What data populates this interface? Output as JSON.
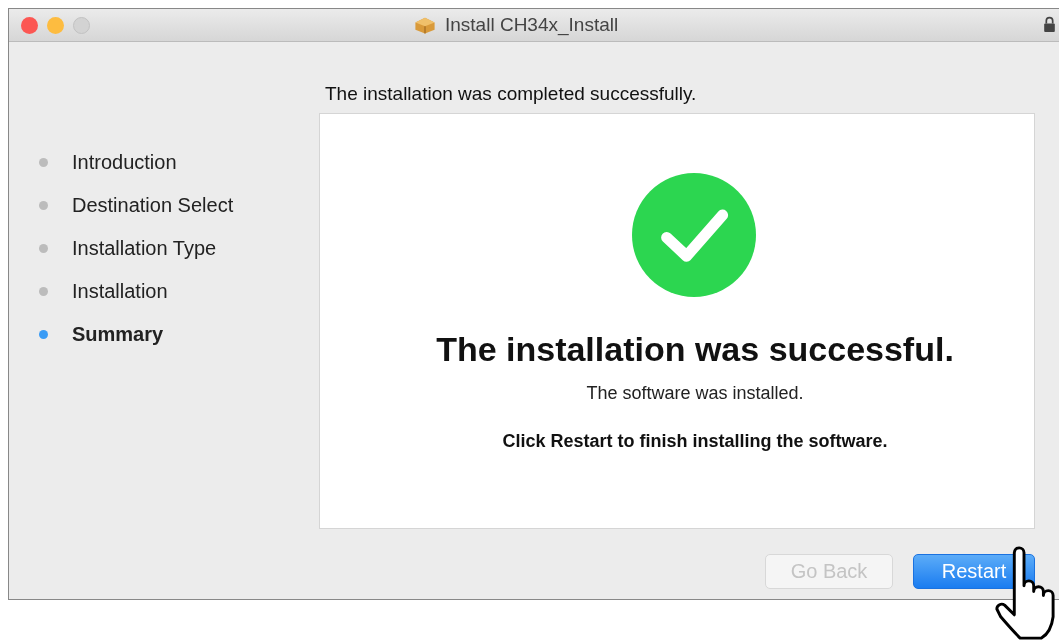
{
  "window": {
    "title": "Install CH34x_Install"
  },
  "heading": "The installation was completed successfully.",
  "steps": [
    {
      "label": "Introduction",
      "selected": false
    },
    {
      "label": "Destination Select",
      "selected": false
    },
    {
      "label": "Installation Type",
      "selected": false
    },
    {
      "label": "Installation",
      "selected": false
    },
    {
      "label": "Summary",
      "selected": true
    }
  ],
  "result": {
    "title": "The installation was successful.",
    "message": "The software was installed.",
    "instruction": "Click Restart to finish installing the software."
  },
  "buttons": [
    {
      "label": "Go Back",
      "disabled": true,
      "kind": "secondary"
    },
    {
      "label": "Restart",
      "disabled": false,
      "kind": "primary"
    }
  ]
}
